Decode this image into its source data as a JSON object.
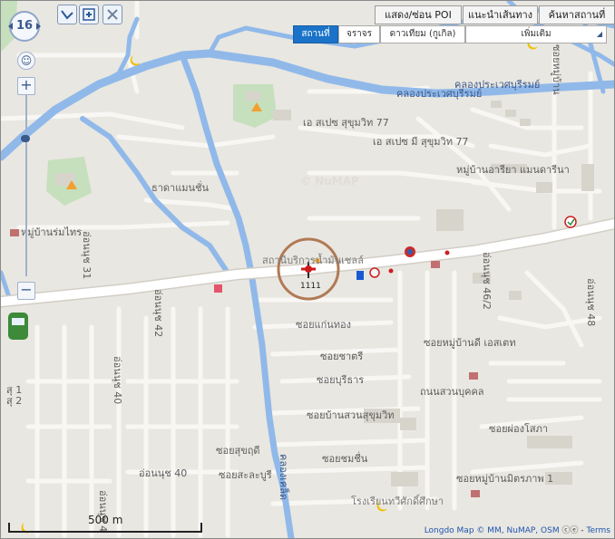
{
  "map": {
    "zoom_level": "16",
    "pin_label": "1111",
    "scale_label": "500 m",
    "attribution_text": "Longdo Map © MM, NuMAP, OSM",
    "terms_label": "Terms",
    "watermark": "© NuMAP",
    "colors": {
      "land": "#e9e7e1",
      "road": "#ffffff",
      "road_outline": "#d2cec6",
      "water": "#90b9ea",
      "park": "#c6dfbd",
      "circle": "#b07a55",
      "tab_active": "#1a73c9"
    }
  },
  "toolbar": {
    "poi_toggle_label": "แสดง/ซ่อน POI",
    "route_label": "แนะนำเส้นทาง",
    "search_label": "ค้นหาสถานที่"
  },
  "layers": {
    "tabs": [
      "สถานที่",
      "จราจร",
      "ดาวเทียม (กูเกิล)"
    ],
    "more_label": "เพิ่มเติม"
  },
  "nav": {
    "icons": [
      "route-icon",
      "locate-icon",
      "close-icon"
    ]
  },
  "labels": {
    "canal_top": "คลองประเวศบุรีรมย์",
    "canal_top2": "คลองประเวศบุรีรมย์",
    "sp77": "เอ สเปซ สุขุมวิท 77",
    "sp77_2": "เอ สเปซ มี สุขุมวิท 77",
    "moo_ban_arya": "หมู่บ้านอารียา แมนดารีนา",
    "thada": "ธาดาแมนชั่น",
    "moo_ban_rom": "หมู่บ้านร่มไทร",
    "onnut31": "อ่อนนุช 31",
    "onnut42": "อ่อนนุช 42",
    "onnut40_v": "อ่อนนุช 40",
    "onnut40_h": "อ่อนนุช 40",
    "onnut4x": "อ่อนนุช 4",
    "onnut462": "อ่อนนุช 46/2",
    "onnut48": "อ่อนนุช 48",
    "station": "สถานีบริการน้ำมันเชลล์",
    "kaen_thong": "ซอยแก่นทอง",
    "moo_ban_di": "ซอยหมู่บ้านดี เอสเตท",
    "chatri": "ซอยชาตรี",
    "buri": "ซอยบุรีธาร",
    "suan_buk": "ถนนสวนบุคคล",
    "suan_sukhumvit": "ซอยบ้านสวนสุขุมวิท",
    "mong_sophar": "ซอยผ่องโสภา",
    "sukudi": "ซอยสุขฤดี",
    "salabu": "ซอยสะละบูรี",
    "chomchuen": "ซอยชมชื่น",
    "mitraphap": "ซอยหมู่บ้านมิตรภาพ 1",
    "school": "โรงเรียนทวีศักดิ์ศึกษา",
    "khlong_v": "คลองเคล็ด",
    "sukhumvit_right": "สุขุมวิท 77",
    "soi_right": "ซอยหมู่บ้าน",
    "left_1": "สุ 1",
    "left_2": "สุ 2"
  }
}
